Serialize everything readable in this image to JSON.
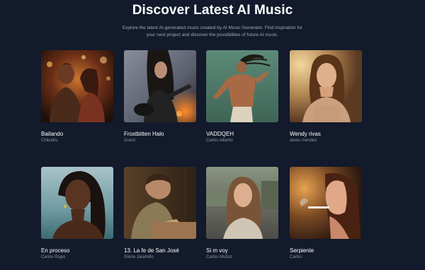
{
  "header": {
    "title": "Discover Latest AI Music",
    "subtitle_line1": "Explore the latest AI-generated music created by AI Music Generator. Find inspiration for",
    "subtitle_line2": "your next project and discover the possibilities of future AI music."
  },
  "songs": [
    {
      "title": "Bailando",
      "author": "Chikuliru",
      "image": "couple-dancing-warm-lights"
    },
    {
      "title": "Frostbitten Halo",
      "author": "Guest",
      "image": "long-haired-guitarist"
    },
    {
      "title": "VADDQEH",
      "author": "Carlos Alberto",
      "image": "dancer-with-dreadlocks"
    },
    {
      "title": "Wendy rivas",
      "author": "alexis mendez",
      "image": "woman-portrait-sunset"
    },
    {
      "title": "En proceso",
      "author": "Carlos Rojas",
      "image": "woman-portrait-beach"
    },
    {
      "title": "13. La fe de San José",
      "author": "Gloria Jaramillo",
      "image": "carpenter-at-workbench"
    },
    {
      "title": "Si m voy",
      "author": "Carlos Muñoz",
      "image": "woman-in-street"
    },
    {
      "title": "Serpiente",
      "author": "Carlos",
      "image": "woman-smoking-profile"
    }
  ]
}
